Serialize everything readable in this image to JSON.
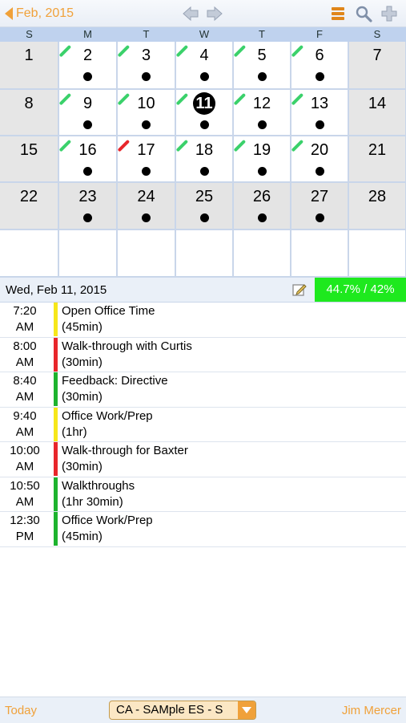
{
  "header": {
    "back_label": "Feb, 2015",
    "icons": [
      "prev-arrow-icon",
      "next-arrow-icon",
      "list-icon",
      "search-icon",
      "add-icon"
    ]
  },
  "calendar": {
    "days_of_week": [
      "S",
      "M",
      "T",
      "W",
      "T",
      "F",
      "S"
    ],
    "weeks": [
      [
        {
          "d": "1",
          "w": true
        },
        {
          "d": "2",
          "dot": true,
          "flag": "green"
        },
        {
          "d": "3",
          "dot": true,
          "flag": "green"
        },
        {
          "d": "4",
          "dot": true,
          "flag": "green"
        },
        {
          "d": "5",
          "dot": true,
          "flag": "green"
        },
        {
          "d": "6",
          "dot": true,
          "flag": "green"
        },
        {
          "d": "7",
          "w": true
        }
      ],
      [
        {
          "d": "8",
          "w": true
        },
        {
          "d": "9",
          "dot": true,
          "flag": "green"
        },
        {
          "d": "10",
          "dot": true,
          "flag": "green"
        },
        {
          "d": "11",
          "dot": true,
          "flag": "green",
          "selected": true
        },
        {
          "d": "12",
          "dot": true,
          "flag": "green"
        },
        {
          "d": "13",
          "dot": true,
          "flag": "green"
        },
        {
          "d": "14",
          "w": true
        }
      ],
      [
        {
          "d": "15",
          "w": true
        },
        {
          "d": "16",
          "dot": true,
          "flag": "green"
        },
        {
          "d": "17",
          "dot": true,
          "flag": "red"
        },
        {
          "d": "18",
          "dot": true,
          "flag": "green"
        },
        {
          "d": "19",
          "dot": true,
          "flag": "green"
        },
        {
          "d": "20",
          "dot": true,
          "flag": "green"
        },
        {
          "d": "21",
          "w": true
        }
      ],
      [
        {
          "d": "22",
          "w": true
        },
        {
          "d": "23",
          "dot": true,
          "g": true
        },
        {
          "d": "24",
          "dot": true,
          "g": true
        },
        {
          "d": "25",
          "dot": true,
          "g": true
        },
        {
          "d": "26",
          "dot": true,
          "g": true
        },
        {
          "d": "27",
          "dot": true,
          "g": true
        },
        {
          "d": "28",
          "w": true
        }
      ],
      [
        {
          "d": ""
        },
        {
          "d": ""
        },
        {
          "d": ""
        },
        {
          "d": ""
        },
        {
          "d": ""
        },
        {
          "d": ""
        },
        {
          "d": ""
        }
      ]
    ],
    "colors": {
      "green": "#3bd16b",
      "red": "#e8262b"
    }
  },
  "day": {
    "date_label": "Wed, Feb 11, 2015",
    "percent_label": "44.7% / 42%"
  },
  "events": [
    {
      "time1": "7:20",
      "time2": "AM",
      "title": "Open Office Time",
      "duration": "(45min)",
      "color": "#f6e71a"
    },
    {
      "time1": "8:00",
      "time2": "AM",
      "title": "Walk-through with Curtis",
      "duration": "(30min)",
      "color": "#e8262b"
    },
    {
      "time1": "8:40",
      "time2": "AM",
      "title": "Feedback: Directive",
      "duration": "(30min)",
      "color": "#1db32e"
    },
    {
      "time1": "9:40",
      "time2": "AM",
      "title": "Office Work/Prep",
      "duration": "(1hr)",
      "color": "#f6e71a"
    },
    {
      "time1": "10:00",
      "time2": "AM",
      "title": "Walk-through for Baxter",
      "duration": "(30min)",
      "color": "#e8262b"
    },
    {
      "time1": "10:50",
      "time2": "AM",
      "title": "Walkthroughs",
      "duration": "(1hr 30min)",
      "color": "#1db32e"
    },
    {
      "time1": "12:30",
      "time2": "PM",
      "title": "Office Work/Prep",
      "duration": "(45min)",
      "color": "#1db32e"
    }
  ],
  "footer": {
    "today_label": "Today",
    "school_select_value": "CA - SAMple ES - S",
    "user_label": "Jim Mercer"
  }
}
